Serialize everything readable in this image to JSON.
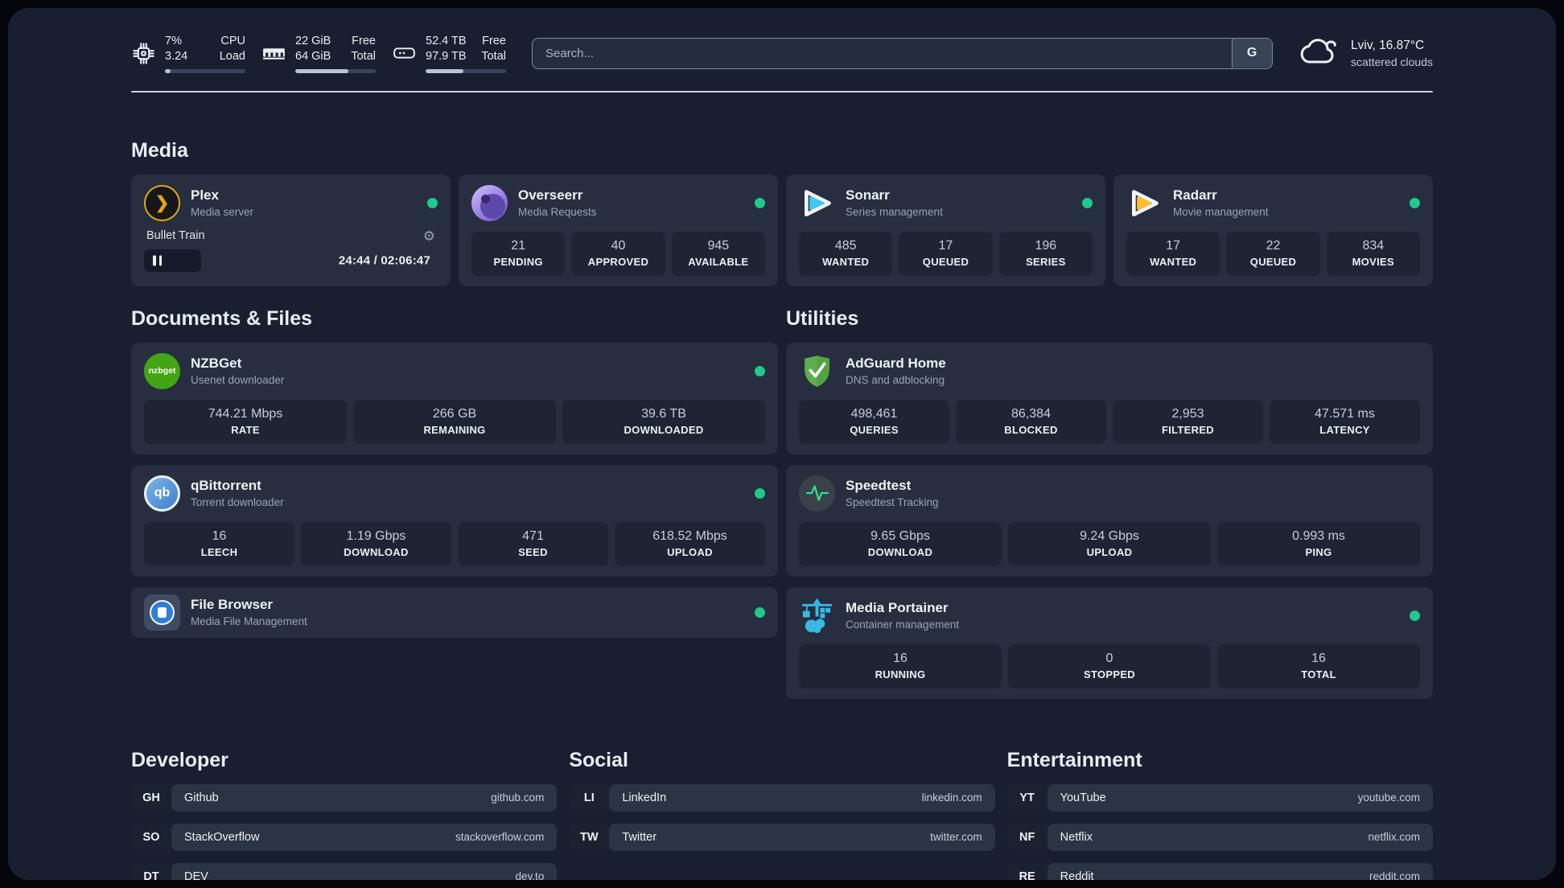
{
  "header": {
    "metrics": [
      {
        "icon": "cpu-icon",
        "values": [
          "7%",
          "3.24"
        ],
        "labels": [
          "CPU",
          "Load"
        ],
        "progress": 7
      },
      {
        "icon": "ram-icon",
        "values": [
          "22 GiB",
          "64 GiB"
        ],
        "labels": [
          "Free",
          "Total"
        ],
        "progress": 66
      },
      {
        "icon": "disk-icon",
        "values": [
          "52.4 TB",
          "97.9 TB"
        ],
        "labels": [
          "Free",
          "Total"
        ],
        "progress": 47
      }
    ],
    "search": {
      "placeholder": "Search...",
      "engine_button": "G"
    },
    "weather": {
      "location": "Lviv, 16.87°C",
      "condition": "scattered clouds"
    }
  },
  "sections": {
    "media": {
      "title": "Media",
      "plex": {
        "name": "Plex",
        "description": "Media server",
        "online": true,
        "now_playing": {
          "title": "Bullet Train",
          "time_display": "24:44 / 02:06:47",
          "progress_percent": 19.5
        }
      },
      "overseerr": {
        "name": "Overseerr",
        "description": "Media Requests",
        "online": true,
        "stats": [
          {
            "value": "21",
            "label": "PENDING"
          },
          {
            "value": "40",
            "label": "APPROVED"
          },
          {
            "value": "945",
            "label": "AVAILABLE"
          }
        ]
      },
      "sonarr": {
        "name": "Sonarr",
        "description": "Series management",
        "online": true,
        "stats": [
          {
            "value": "485",
            "label": "WANTED"
          },
          {
            "value": "17",
            "label": "QUEUED"
          },
          {
            "value": "196",
            "label": "SERIES"
          }
        ]
      },
      "radarr": {
        "name": "Radarr",
        "description": "Movie management",
        "online": true,
        "stats": [
          {
            "value": "17",
            "label": "WANTED"
          },
          {
            "value": "22",
            "label": "QUEUED"
          },
          {
            "value": "834",
            "label": "MOVIES"
          }
        ]
      }
    },
    "documents": {
      "title": "Documents & Files",
      "nzbget": {
        "name": "NZBGet",
        "description": "Usenet downloader",
        "online": true,
        "icon_text": "nzbget",
        "stats": [
          {
            "value": "744.21 Mbps",
            "label": "RATE"
          },
          {
            "value": "266 GB",
            "label": "REMAINING"
          },
          {
            "value": "39.6 TB",
            "label": "DOWNLOADED"
          }
        ]
      },
      "qbittorrent": {
        "name": "qBittorrent",
        "description": "Torrent downloader",
        "online": true,
        "icon_text": "qb",
        "stats": [
          {
            "value": "16",
            "label": "LEECH"
          },
          {
            "value": "1.19 Gbps",
            "label": "DOWNLOAD"
          },
          {
            "value": "471",
            "label": "SEED"
          },
          {
            "value": "618.52 Mbps",
            "label": "UPLOAD"
          }
        ]
      },
      "filebrowser": {
        "name": "File Browser",
        "description": "Media File Management",
        "online": true
      }
    },
    "utilities": {
      "title": "Utilities",
      "adguard": {
        "name": "AdGuard Home",
        "description": "DNS and adblocking",
        "online": false,
        "stats": [
          {
            "value": "498,461",
            "label": "QUERIES"
          },
          {
            "value": "86,384",
            "label": "BLOCKED"
          },
          {
            "value": "2,953",
            "label": "FILTERED"
          },
          {
            "value": "47.571 ms",
            "label": "LATENCY"
          }
        ]
      },
      "speedtest": {
        "name": "Speedtest",
        "description": "Speedtest Tracking",
        "online": false,
        "stats": [
          {
            "value": "9.65 Gbps",
            "label": "DOWNLOAD"
          },
          {
            "value": "9.24 Gbps",
            "label": "UPLOAD"
          },
          {
            "value": "0.993 ms",
            "label": "PING"
          }
        ]
      },
      "portainer": {
        "name": "Media Portainer",
        "description": "Container management",
        "online": true,
        "stats": [
          {
            "value": "16",
            "label": "RUNNING"
          },
          {
            "value": "0",
            "label": "STOPPED"
          },
          {
            "value": "16",
            "label": "TOTAL"
          }
        ]
      }
    },
    "bookmarks": [
      {
        "title": "Developer",
        "links": [
          {
            "abbr": "GH",
            "name": "Github",
            "url": "github.com"
          },
          {
            "abbr": "SO",
            "name": "StackOverflow",
            "url": "stackoverflow.com"
          },
          {
            "abbr": "DT",
            "name": "DEV",
            "url": "dev.to"
          }
        ]
      },
      {
        "title": "Social",
        "links": [
          {
            "abbr": "LI",
            "name": "LinkedIn",
            "url": "linkedin.com"
          },
          {
            "abbr": "TW",
            "name": "Twitter",
            "url": "twitter.com"
          }
        ]
      },
      {
        "title": "Entertainment",
        "links": [
          {
            "abbr": "YT",
            "name": "YouTube",
            "url": "youtube.com"
          },
          {
            "abbr": "NF",
            "name": "Netflix",
            "url": "netflix.com"
          },
          {
            "abbr": "RE",
            "name": "Reddit",
            "url": "reddit.com"
          }
        ]
      }
    ]
  },
  "colors": {
    "background": "#181f31",
    "card": "#262e3f",
    "stat_tile": "#1d2535",
    "online_dot": "#22c78b",
    "plex_accent": "#e7a410",
    "sonarr_accent": "#3fc8f4",
    "radarr_accent": "#fcbe30",
    "nzbget_accent": "#43a513",
    "qbittorrent_accent": "#4a90d9",
    "adguard_accent": "#5fae4e",
    "speedtest_accent": "#35e08a",
    "portainer_accent": "#39b9e5",
    "filebrowser_accent": "#2e7fd8"
  }
}
